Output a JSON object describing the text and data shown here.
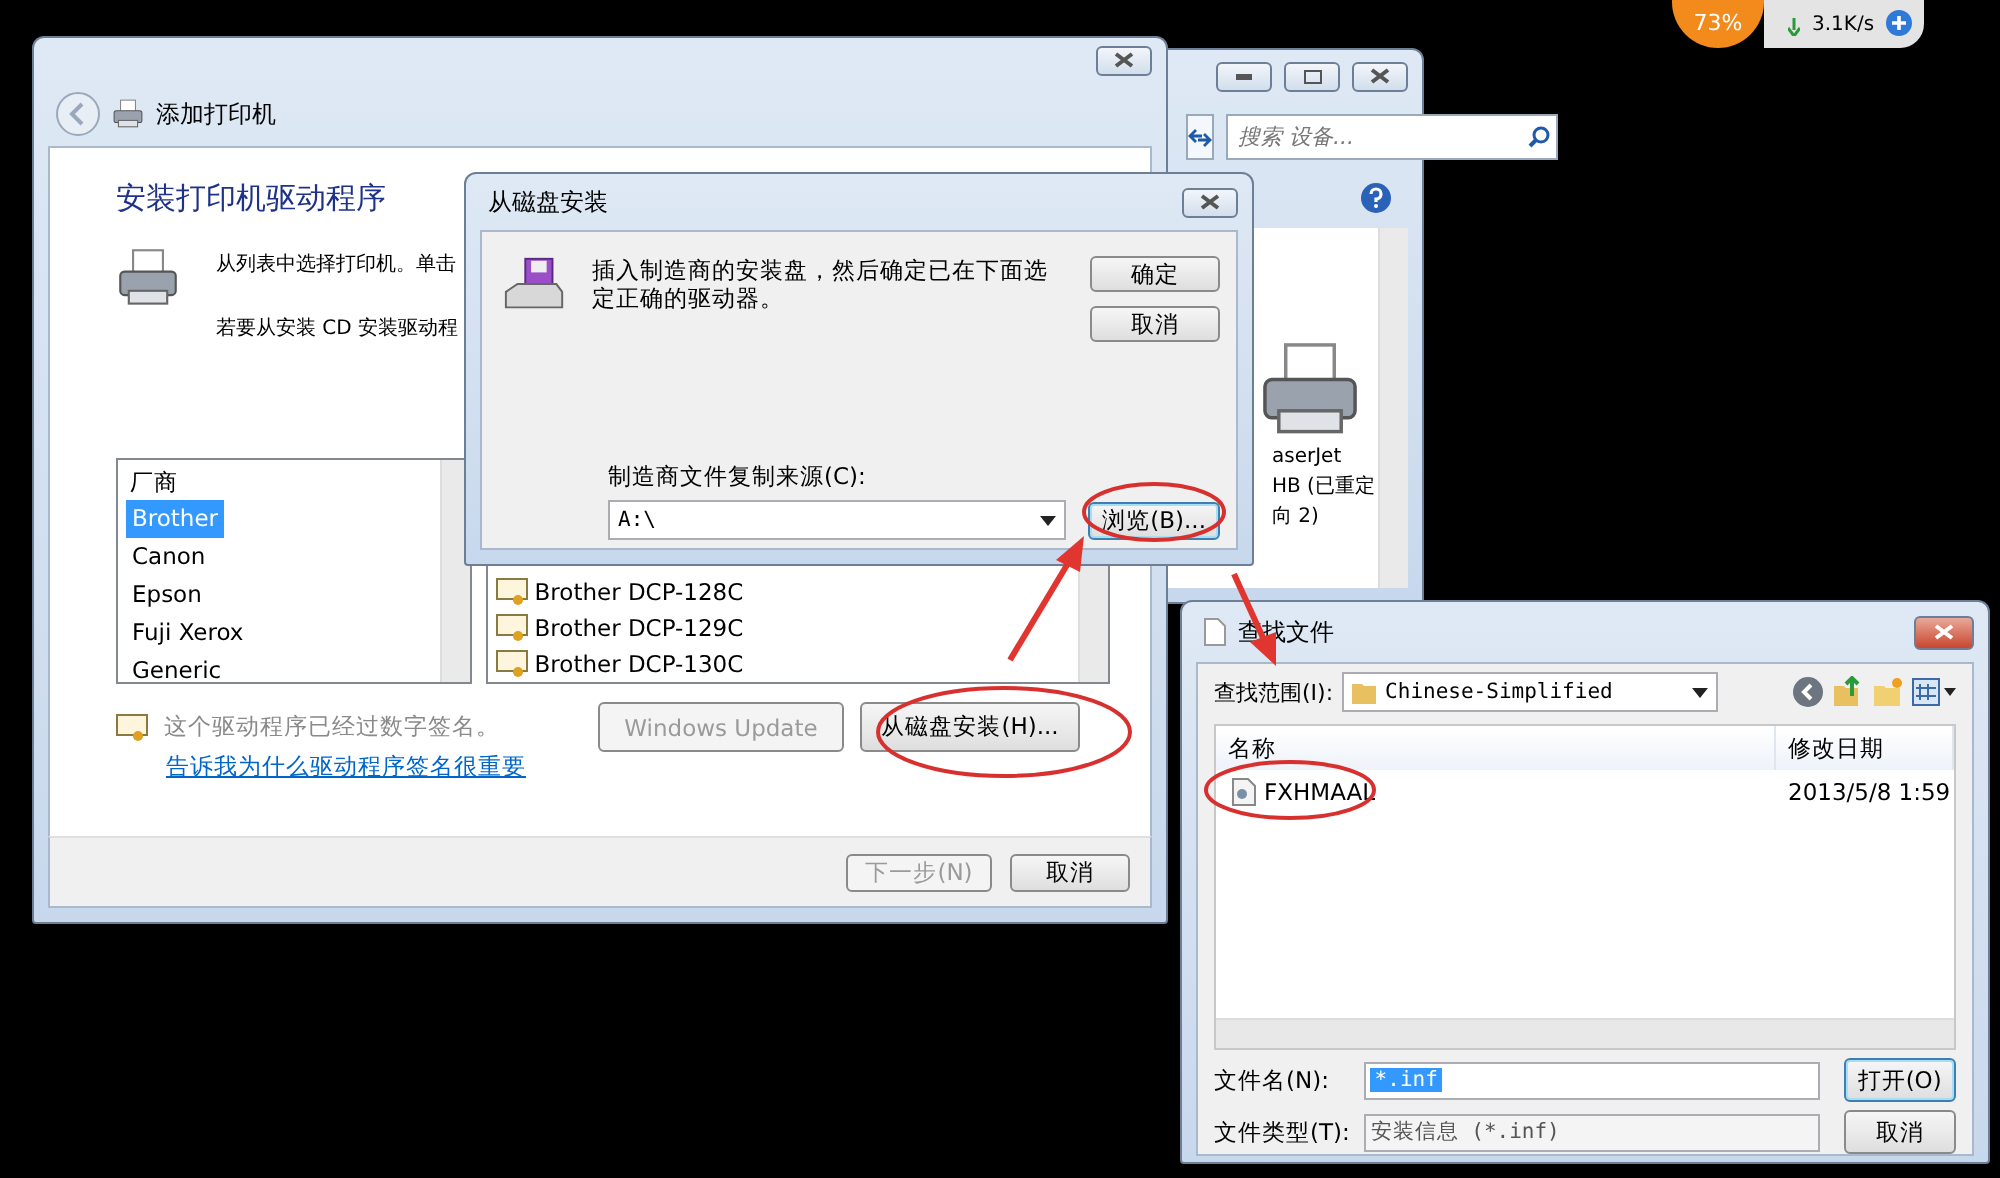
{
  "desktop_widget": {
    "percent": "73%",
    "speed": "3.1K/s"
  },
  "devices_window": {
    "search": {
      "placeholder": "搜索 设备..."
    },
    "printer_label": [
      "aserJet",
      "HB (已重定",
      "向 2)"
    ]
  },
  "wizard": {
    "title": "添加打印机",
    "heading": "安装打印机驱动程序",
    "instructions": [
      "从列表中选择打印机。单击",
      "若要从安装 CD 安装驱动程"
    ],
    "manufacturers": {
      "header": "厂商",
      "items": [
        {
          "label": "Brother",
          "selected": true
        },
        {
          "label": "Canon",
          "selected": false
        },
        {
          "label": "Epson",
          "selected": false
        },
        {
          "label": "Fuji Xerox",
          "selected": false
        },
        {
          "label": "Generic",
          "selected": false
        }
      ]
    },
    "printers": [
      "Brother DCP-128C",
      "Brother DCP-129C",
      "Brother DCP-130C"
    ],
    "signature_note": "这个驱动程序已经过数字签名。",
    "buttons": [
      {
        "label": "Windows Update",
        "disabled": true
      },
      {
        "label": "从磁盘安装(H)...",
        "disabled": false
      }
    ],
    "link": "告诉我为什么驱动程序签名很重要",
    "footer_buttons": [
      {
        "label": "下一步(N)",
        "disabled": true
      },
      {
        "label": "取消",
        "disabled": false
      }
    ]
  },
  "disk_dialog": {
    "title": "从磁盘安装",
    "message": "插入制造商的安装盘，然后确定已在下面选定正确的驱动器。",
    "buttons": [
      "确定",
      "取消"
    ],
    "source_label": "制造商文件复制来源(C):",
    "source_value": "A:\\",
    "browse": "浏览(B)..."
  },
  "find_dialog": {
    "title": "查找文件",
    "look_in_label": "查找范围(I):",
    "folder": "Chinese-Simplified",
    "columns": [
      "名称",
      "修改日期"
    ],
    "files": [
      {
        "name": "FXHMAAL",
        "modified": "2013/5/8 1:59"
      }
    ],
    "file_name_label": "文件名(N):",
    "file_name": "*.inf",
    "file_type_label": "文件类型(T):",
    "file_type": "安装信息 (*.inf)",
    "buttons": [
      "打开(O)",
      "取消"
    ]
  }
}
